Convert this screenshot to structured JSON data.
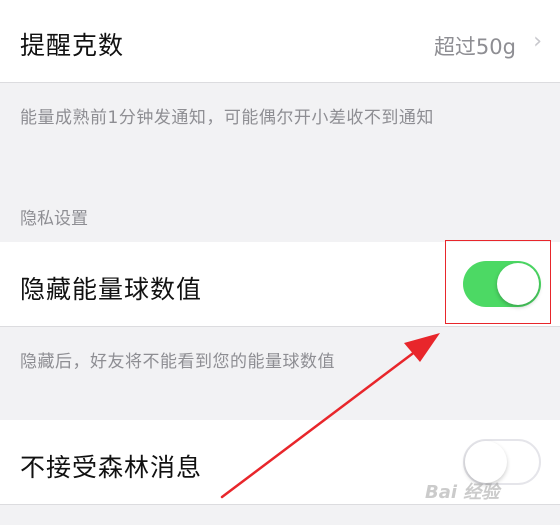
{
  "reminder_row": {
    "label": "提醒克数",
    "value": "超过50g",
    "chevron": "chevron-right-icon"
  },
  "reminder_note": "能量成熟前1分钟发通知，可能偶尔开小差收不到通知",
  "privacy_section": {
    "title": "隐私设置"
  },
  "hide_energy_row": {
    "label": "隐藏能量球数值",
    "toggle_state": "on"
  },
  "hide_energy_note": "隐藏后，好友将不能看到您的能量球数值",
  "forest_message_row": {
    "label": "不接受森林消息",
    "toggle_state": "off"
  },
  "watermark": "Bai 经验",
  "colors": {
    "toggle_on": "#4cd964",
    "annotation_red": "#e8262b",
    "background": "#f2f2f4"
  }
}
